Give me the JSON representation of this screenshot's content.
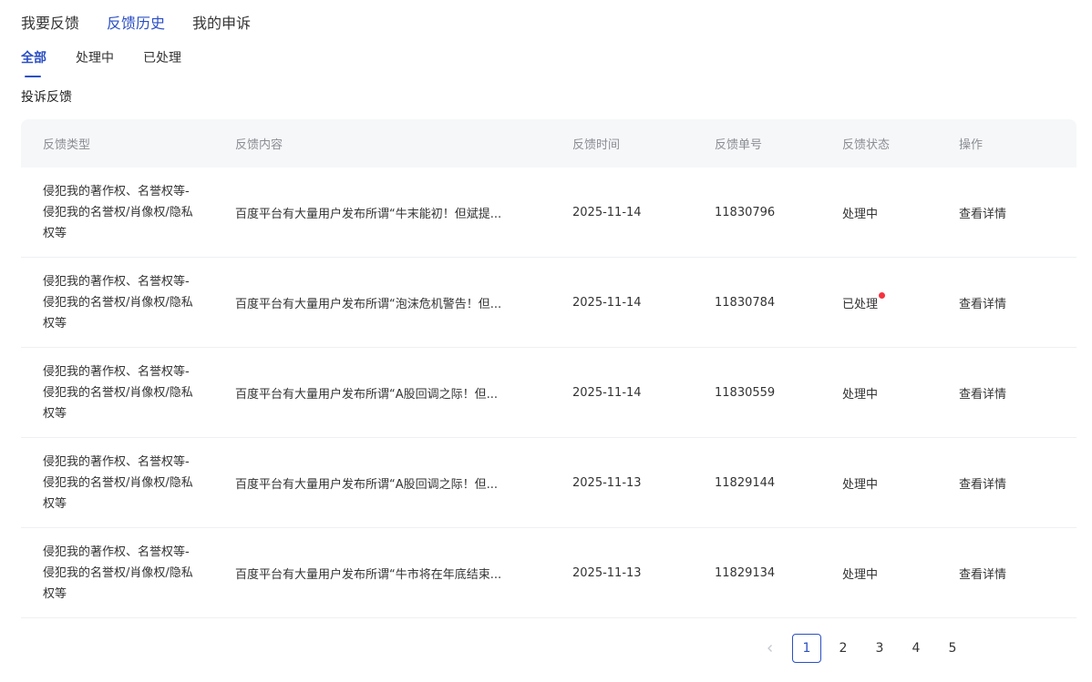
{
  "top_tabs": [
    {
      "label": "我要反馈",
      "active": false
    },
    {
      "label": "反馈历史",
      "active": true
    },
    {
      "label": "我的申诉",
      "active": false
    }
  ],
  "sub_tabs": [
    {
      "label": "全部",
      "active": true
    },
    {
      "label": "处理中",
      "active": false
    },
    {
      "label": "已处理",
      "active": false
    }
  ],
  "section_title": "投诉反馈",
  "table": {
    "headers": [
      "反馈类型",
      "反馈内容",
      "反馈时间",
      "反馈单号",
      "反馈状态",
      "操作"
    ],
    "rows": [
      {
        "type": "侵犯我的著作权、名誉权等-侵犯我的名誉权/肖像权/隐私权等",
        "content": "百度平台有大量用户发布所谓“牛末能初！但斌提...",
        "time": "2025-11-14",
        "id": "11830796",
        "status": "处理中",
        "new": false,
        "action": "查看详情"
      },
      {
        "type": "侵犯我的著作权、名誉权等-侵犯我的名誉权/肖像权/隐私权等",
        "content": "百度平台有大量用户发布所谓“泡沫危机警告！但...",
        "time": "2025-11-14",
        "id": "11830784",
        "status": "已处理",
        "new": true,
        "action": "查看详情"
      },
      {
        "type": "侵犯我的著作权、名誉权等-侵犯我的名誉权/肖像权/隐私权等",
        "content": "百度平台有大量用户发布所谓“A股回调之际！但...",
        "time": "2025-11-14",
        "id": "11830559",
        "status": "处理中",
        "new": false,
        "action": "查看详情"
      },
      {
        "type": "侵犯我的著作权、名誉权等-侵犯我的名誉权/肖像权/隐私权等",
        "content": "百度平台有大量用户发布所谓“A股回调之际！但...",
        "time": "2025-11-13",
        "id": "11829144",
        "status": "处理中",
        "new": false,
        "action": "查看详情"
      },
      {
        "type": "侵犯我的著作权、名誉权等-侵犯我的名誉权/肖像权/隐私权等",
        "content": "百度平台有大量用户发布所谓“牛市将在年底结束...",
        "time": "2025-11-13",
        "id": "11829134",
        "status": "处理中",
        "new": false,
        "action": "查看详情"
      }
    ]
  },
  "pagination": {
    "pages": [
      "1",
      "2",
      "3",
      "4",
      "5"
    ],
    "current": "1"
  },
  "colors": {
    "accent": "#2b4fc4",
    "header_bg": "#f6f7f9",
    "badge_dot": "#f5333f"
  },
  "icons": {
    "prev": "chevron-left-icon",
    "new_dot": "red-dot-icon"
  }
}
